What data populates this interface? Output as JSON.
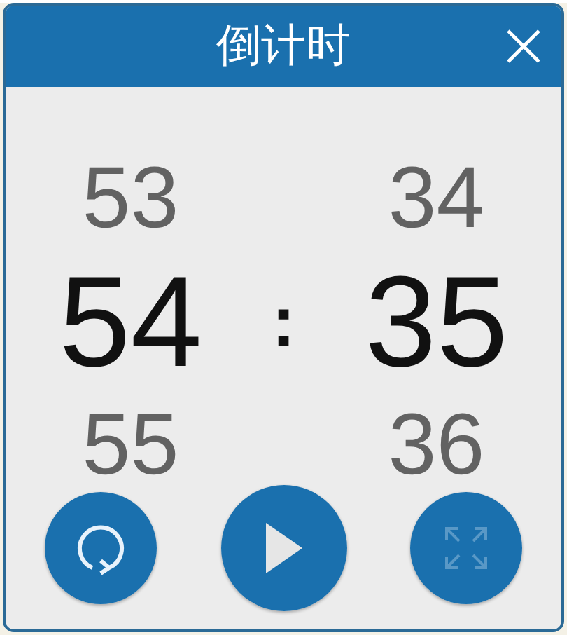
{
  "window": {
    "title": "倒计时"
  },
  "wheels": [
    {
      "previous": "53",
      "current": "54",
      "next": "55"
    },
    {
      "previous": "34",
      "current": "35",
      "next": "36"
    }
  ],
  "separator": ":",
  "buttons": [
    {
      "kind": "reset",
      "disabled": false
    },
    {
      "kind": "play",
      "disabled": false
    },
    {
      "kind": "expand",
      "disabled": true
    }
  ]
}
